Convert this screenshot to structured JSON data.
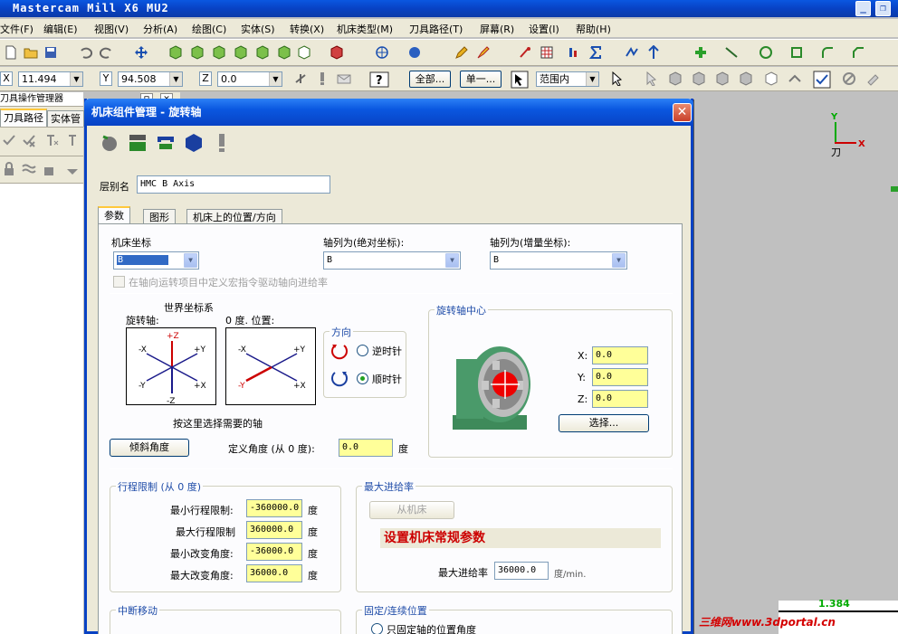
{
  "app": {
    "title": "Mastercam Mill X6 MU2"
  },
  "menu": [
    "文件(F)",
    "编辑(E)",
    "视图(V)",
    "分析(A)",
    "绘图(C)",
    "实体(S)",
    "转换(X)",
    "机床类型(M)",
    "刀具路径(T)",
    "屏幕(R)",
    "设置(I)",
    "帮助(H)"
  ],
  "coords": {
    "x_label": "X",
    "x_value": "11.494",
    "y_label": "Y",
    "y_value": "94.508",
    "z_label": "Z",
    "z_value": "0.0"
  },
  "toolbar2": {
    "all_btn": "全部...",
    "single_btn": "单一...",
    "range_select": "范围内"
  },
  "leftpanel": {
    "title": "刀具操作管理器",
    "tab_toolpath": "刀具路径",
    "tab_solids": "实体管"
  },
  "viewport": {
    "axis_y": "Y",
    "axis_x": "X",
    "axis_label": "刀",
    "readout": "1.384",
    "watermark": "三维网www.3dportal.cn"
  },
  "dialog": {
    "title": "机床组件管理 - 旋转轴",
    "close": "✕",
    "layer_label": "层别名",
    "layer_value": "HMC B Axis",
    "tabs": [
      "参数",
      "图形",
      "机床上的位置/方向"
    ],
    "machine_coord_label": "机床坐标",
    "machine_coord_value": "B",
    "abs_axis_label": "轴列为(绝对坐标):",
    "abs_axis_value": "B",
    "inc_axis_label": "轴列为(增量坐标):",
    "inc_axis_value": "B",
    "macro_checkbox": "在轴向运转项目中定义宏指令驱动轴向进给率",
    "world_coord_title": "世界坐标系",
    "rot_axis_label": "旋转轴:",
    "zero_pos_label": "0 度. 位置:",
    "direction_title": "方向",
    "ccw_label": "逆时针",
    "cw_label": "顺时针",
    "select_axis_hint": "按这里选择需要的轴",
    "tilt_button": "倾斜角度",
    "define_angle_label": "定义角度 (从 0 度):",
    "define_angle_value": "0.0",
    "deg": "度",
    "center_title": "旋转轴中心",
    "center_x_label": "X:",
    "center_x": "0.0",
    "center_y_label": "Y:",
    "center_y": "0.0",
    "center_z_label": "Z:",
    "center_z": "0.0",
    "select_button": "选择...",
    "travel_title": "行程限制 (从 0 度)",
    "min_travel_label": "最小行程限制:",
    "min_travel": "-360000.0",
    "max_travel_label": "最大行程限制",
    "max_travel": "360000.0",
    "min_change_label": "最小改变角度:",
    "min_change": "-36000.0",
    "max_change_label": "最大改变角度:",
    "max_change": "36000.0",
    "feed_title": "最大进给率",
    "from_machine_button": "从机床",
    "overlay_text": "设置机床常规参数",
    "max_feed_label": "最大进给率",
    "max_feed": "36000.0",
    "feed_unit": "度/min.",
    "interrupt_title": "中断移动",
    "fixed_title": "固定/连续位置",
    "fixed_option": "只固定轴的位置角度"
  },
  "colors": {
    "title_blue": "#0842c4",
    "field_yellow": "#ffff99",
    "overlay_red": "#cc0000",
    "turntable_green": "#4a9a6a"
  }
}
